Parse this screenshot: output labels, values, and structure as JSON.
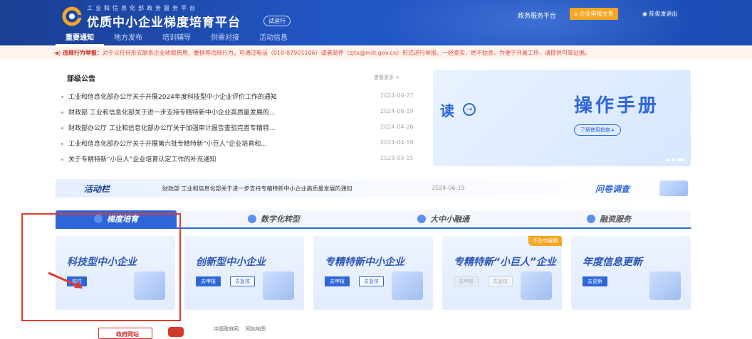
{
  "header": {
    "subtitle": "工业和信息化部政务服务平台",
    "title": "优质中小企业梯度培育平台",
    "trial_badge": "试运行",
    "gov_service": "政务服务平台",
    "home_button": "企业申报主页",
    "user_logout": "陈俊发退出",
    "nav": [
      "重要通知",
      "地方发布",
      "培训辅导",
      "供需对接",
      "活动信息"
    ]
  },
  "alert": {
    "label": "违规行为举报：",
    "text": "对于以任何形式联系企业收取费用、要挟等违规行为，可通过电话（010-87901106）或者邮件（zjtx@miit.gov.cn）形式进行举报。一经查实，绝不姑息。为便于开展工作，请提供可靠证据。"
  },
  "announcements": {
    "title": "部级公告",
    "more": "查看更多 >",
    "items": [
      {
        "text": "工业和信息化部办公厅关于开展2024年度科技型中小企业评价工作的通知",
        "date": "2024-06-27"
      },
      {
        "text": "财政部 工业和信息化部关于进一步支持专精特新中小企业高质量发展的...",
        "date": "2024-06-19"
      },
      {
        "text": "财政部办公厅 工业和信息化部办公厅关于加强审计报告查验完善专精特...",
        "date": "2024-04-26"
      },
      {
        "text": "工业和信息化部办公厅关于开展第六批专精特新“小巨人”企业培育和...",
        "date": "2024-04-18"
      },
      {
        "text": "关于专精特新“小巨人”企业培育认定工作的补充通知",
        "date": "2023-03-15"
      }
    ]
  },
  "banner": {
    "left_text": "读",
    "big_title": "操作手册",
    "guide_button": "了解使用指南 ▸"
  },
  "ticker": {
    "label": "活动栏",
    "text": "财政部 工业和信息化部关于进一步支持专精特新中小企业高质量发展的通知",
    "date": "2024-06-19",
    "survey": "问卷调查"
  },
  "category_tabs": [
    "梯度培育",
    "数字化转型",
    "大中小融通",
    "融资服务"
  ],
  "cards": [
    {
      "title": "科技型中小企业",
      "btn1": "前往",
      "btn2": ""
    },
    {
      "title": "创新型中小企业",
      "btn1": "去申报",
      "btn2": "去复核"
    },
    {
      "title": "专精特新中小企业",
      "btn1": "去申报",
      "btn2": "去复核"
    },
    {
      "title": "专精特新“小巨人”企业",
      "btn1": "去申报",
      "btn2": "去复核",
      "badge": "不在申报期"
    },
    {
      "title": "年度信息更新",
      "btn1": "去更新",
      "btn2": ""
    }
  ],
  "footer": {
    "links": [
      "中国政府网",
      "网站地图"
    ],
    "logo_text": "政府网站"
  },
  "colors": {
    "header_bg": "#1f4fb8",
    "accent": "#2d66d9",
    "alert_text": "#e04b3a",
    "home_button": "#f5a623",
    "annotation_box": "#e23b2e"
  }
}
